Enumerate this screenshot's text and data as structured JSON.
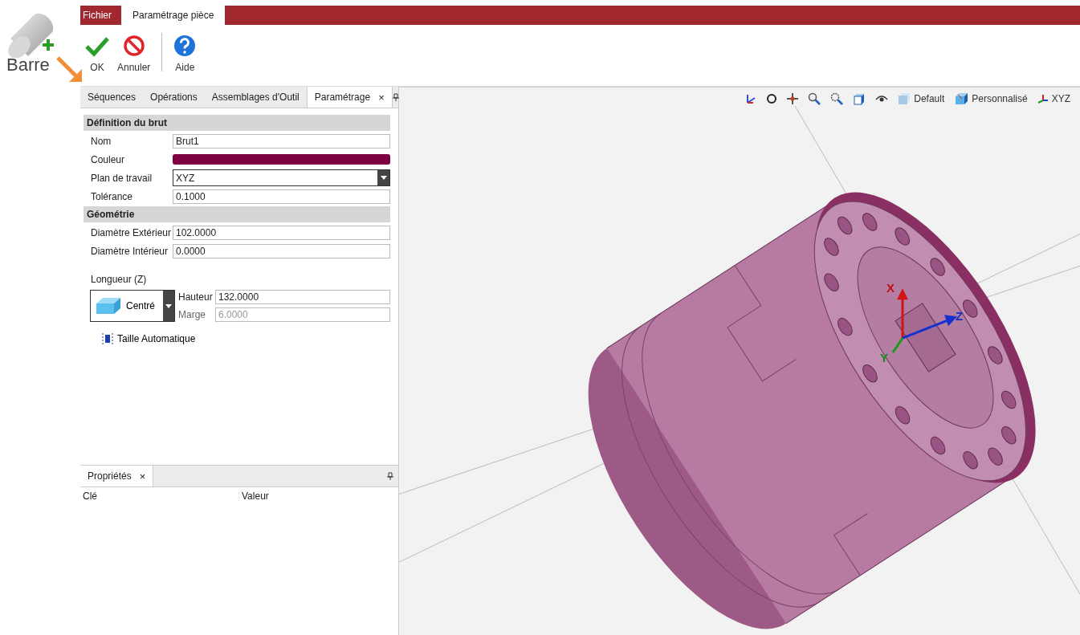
{
  "command": {
    "label": "Barre"
  },
  "ribbon": {
    "tabs": [
      {
        "label": "Fichier",
        "selected": false
      },
      {
        "label": "Paramétrage pièce",
        "selected": true
      }
    ],
    "buttons": [
      {
        "label": "OK",
        "kind": "ok"
      },
      {
        "label": "Annuler",
        "kind": "cancel"
      },
      {
        "label": "Aide",
        "kind": "help"
      }
    ]
  },
  "panel": {
    "tabs": [
      {
        "label": "Séquences",
        "selected": false
      },
      {
        "label": "Opérations",
        "selected": false
      },
      {
        "label": "Assemblages d'Outil",
        "selected": false
      },
      {
        "label": "Paramétrage",
        "selected": true,
        "close": "×"
      }
    ],
    "sections": [
      {
        "title": "Définition du brut",
        "fields": [
          {
            "label": "Nom",
            "kind": "text",
            "value": "Brut1"
          },
          {
            "label": "Couleur",
            "kind": "color",
            "color": "#7d0043"
          },
          {
            "label": "Plan de travail",
            "kind": "select",
            "value": "XYZ"
          },
          {
            "label": "Tolérance",
            "kind": "text",
            "value": "0.1000"
          }
        ]
      },
      {
        "title": "Géométrie",
        "fields": [
          {
            "label": "Diamètre Extérieur",
            "kind": "text",
            "value": "102.0000"
          },
          {
            "label": "Diamètre Intérieur",
            "kind": "text",
            "value": "0.0000"
          }
        ]
      }
    ],
    "length": {
      "title": "Longueur (Z)",
      "mode": "Centré",
      "fields": [
        {
          "label": "Hauteur",
          "value": "132.0000",
          "disabled": false
        },
        {
          "label": "Marge",
          "value": "6.0000",
          "disabled": true
        }
      ],
      "auto_size": "Taille Automatique"
    }
  },
  "properties": {
    "tab": "Propriétés",
    "close": "×",
    "columns": [
      "Clé",
      "Valeur"
    ]
  },
  "viewport": {
    "toolbar": [
      "Default",
      "Personnalisé",
      "XYZ"
    ],
    "axes": [
      "X",
      "Y",
      "Z"
    ]
  }
}
